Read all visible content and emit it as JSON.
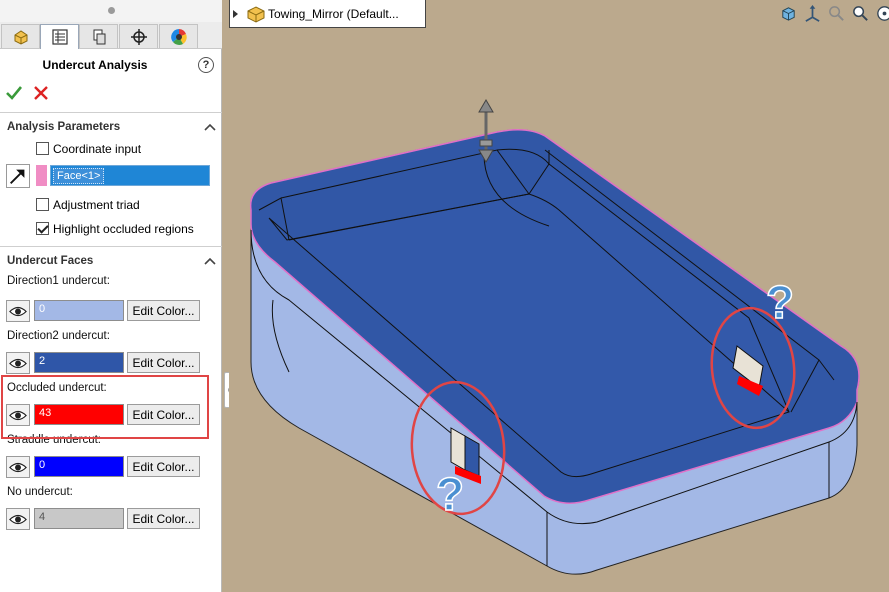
{
  "panel": {
    "tabs": [
      {
        "name": "featuremanager-tab",
        "icon": "part-icon"
      },
      {
        "name": "propertymanager-tab",
        "icon": "property-list-icon"
      },
      {
        "name": "configurationmanager-tab",
        "icon": "configuration-icon"
      },
      {
        "name": "dimxpert-tab",
        "icon": "crosshair-icon"
      },
      {
        "name": "display-manager-tab",
        "icon": "color-wheel-icon"
      }
    ],
    "title": "Undercut Analysis",
    "help": "?",
    "analysis_parameters": {
      "header": "Analysis Parameters",
      "coordinate_input": {
        "label": "Coordinate input",
        "checked": false
      },
      "face_selection": "Face<1>",
      "adjustment_triad": {
        "label": "Adjustment triad",
        "checked": false
      },
      "highlight_occluded": {
        "label": "Highlight occluded regions",
        "checked": true
      }
    },
    "undercut_faces": {
      "header": "Undercut Faces",
      "edit_color_label": "Edit Color...",
      "items": [
        {
          "label": "Direction1 undercut:",
          "count": "0",
          "color": "#a3b8e6",
          "text_color": "#ffffff"
        },
        {
          "label": "Direction2 undercut:",
          "count": "2",
          "color": "#2f56a8",
          "text_color": "#ffffff"
        },
        {
          "label": "Occluded undercut:",
          "count": "43",
          "color": "#ff0000",
          "text_color": "#ffffff"
        },
        {
          "label": "Straddle undercut:",
          "count": "0",
          "color": "#0000ff",
          "text_color": "#ffffff"
        },
        {
          "label": "No undercut:",
          "count": "4",
          "color": "#c8c8c8",
          "text_color": "#555555"
        }
      ]
    }
  },
  "viewport": {
    "tree_label": "Towing_Mirror  (Default...",
    "hud_icons": [
      "view-orientation-icon",
      "triad-icon",
      "zoom-to-fit-icon",
      "zoom-to-area-icon",
      "pan-icon"
    ]
  },
  "colors": {
    "background": "#bba98d",
    "model_inner": "#3157a6",
    "model_outer": "#a3b8e6",
    "occluded": "#ff0000",
    "annotation": "#e04545",
    "question_mark": "#4a8fd1"
  }
}
